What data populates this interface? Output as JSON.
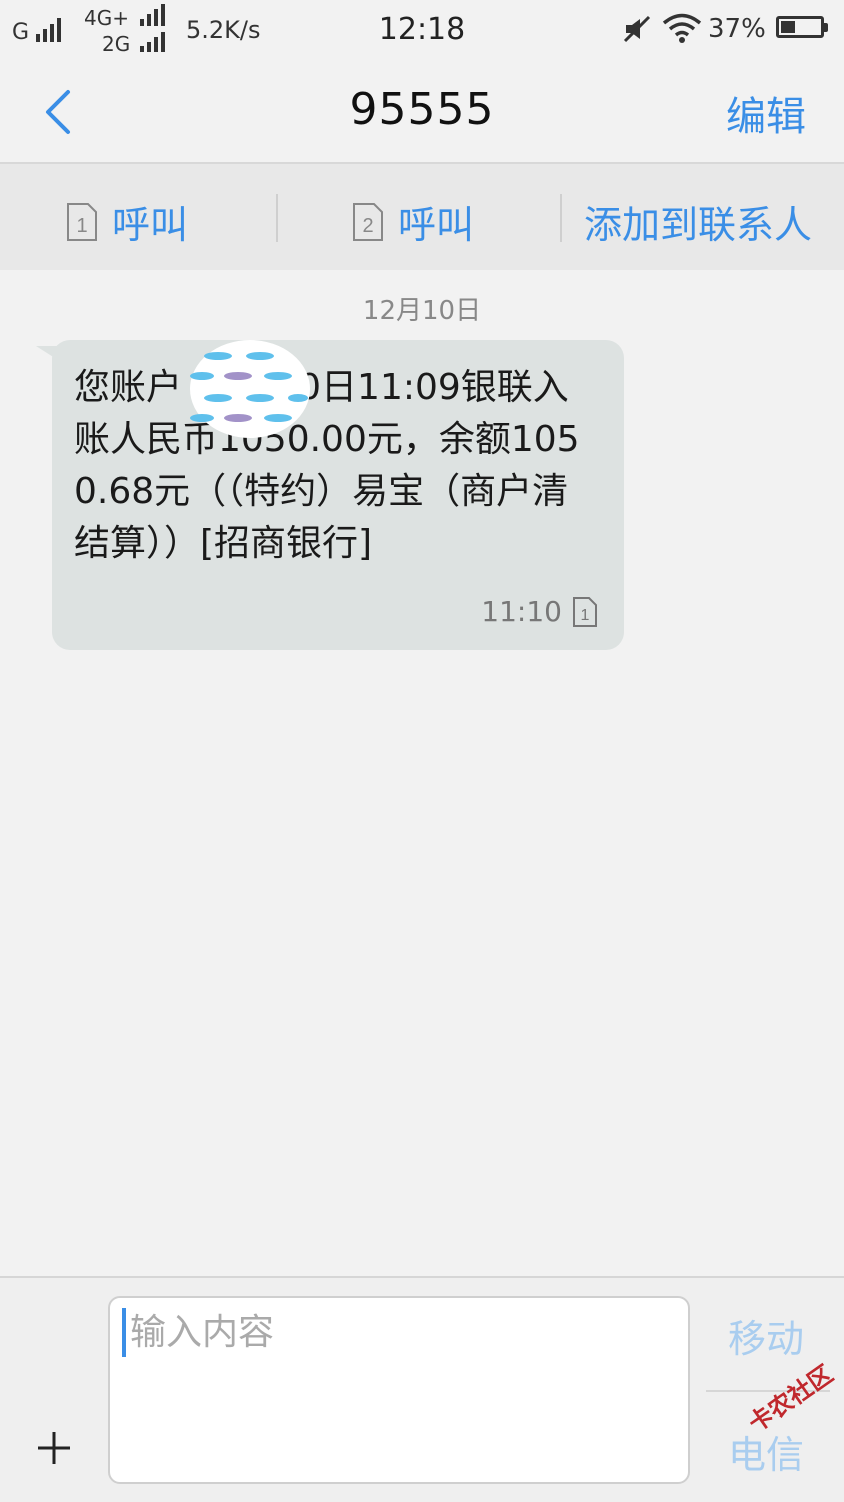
{
  "status_bar": {
    "net1": "G",
    "net2_top": "4G+",
    "net2_bottom": "2G",
    "speed": "5.2K/s",
    "clock": "12:18",
    "battery_pct": "37%",
    "battery_level": 0.37,
    "icons": [
      "signal-icon",
      "mute-icon",
      "wifi-icon",
      "battery-icon"
    ]
  },
  "header": {
    "title": "95555",
    "edit_label": "编辑"
  },
  "actions": {
    "call1_sim": "1",
    "call1_label": "呼叫",
    "call2_sim": "2",
    "call2_label": "呼叫",
    "add_contact_label": "添加到联系人"
  },
  "conversation": {
    "date": "12月10日",
    "message": {
      "text": "您账户  12月10日11:09银联入账人民币1050.00元，余额1050.68元（（特约）易宝（商户清结算））[招商银行]",
      "time": "11:10",
      "sim": "1"
    }
  },
  "composer": {
    "placeholder": "输入内容",
    "send_top": "移动",
    "send_bottom": "电信"
  },
  "watermark": "卡农社区",
  "colors": {
    "accent": "#3a8ee6",
    "bubble": "#dde2e1",
    "background": "#f2f2f2"
  }
}
